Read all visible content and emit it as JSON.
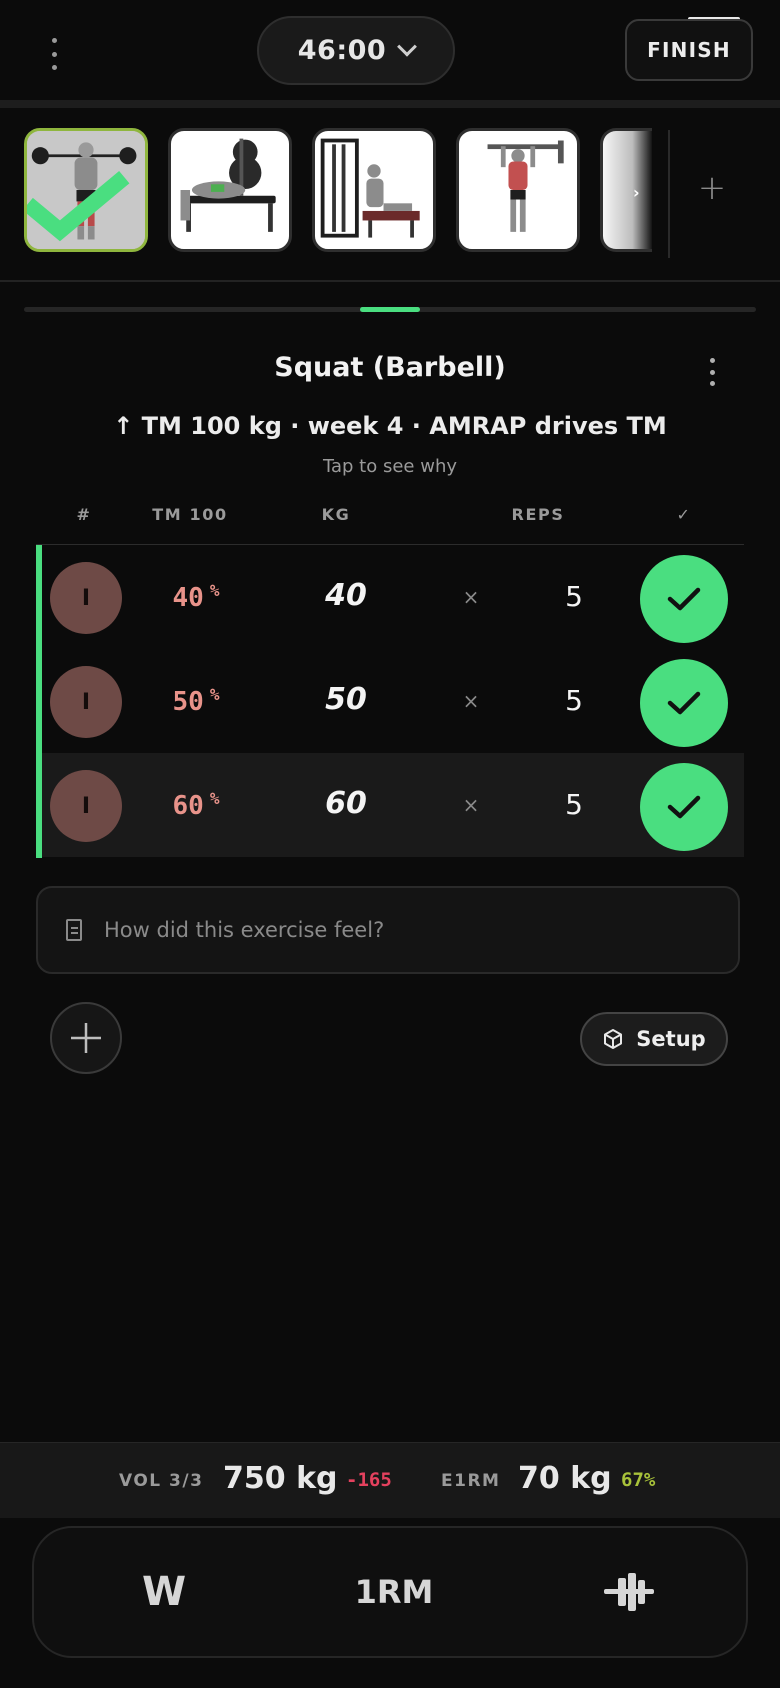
{
  "header": {
    "timer": "46:00",
    "finish_label": "FINISH"
  },
  "thumbnails": [
    {
      "name": "squat-barbell",
      "active": true,
      "done": true
    },
    {
      "name": "bench-press",
      "active": false,
      "done": false
    },
    {
      "name": "seated-row-machine",
      "active": false,
      "done": false
    },
    {
      "name": "pull-up",
      "active": false,
      "done": false
    },
    {
      "name": "next-exercise-partial",
      "active": false,
      "done": false
    }
  ],
  "exercise": {
    "title": "Squat (Barbell)",
    "subtitle": "↑ TM 100 kg · week 4 · AMRAP drives TM",
    "hint": "Tap to see why"
  },
  "table": {
    "headers": {
      "num": "#",
      "tm": "TM 100",
      "kg": "KG",
      "reps": "REPS",
      "check": "✓"
    },
    "rows": [
      {
        "badge": "I",
        "pct": "40",
        "pct_unit": "%",
        "kg": "40",
        "times": "×",
        "reps": "5",
        "done": true
      },
      {
        "badge": "I",
        "pct": "50",
        "pct_unit": "%",
        "kg": "50",
        "times": "×",
        "reps": "5",
        "done": true
      },
      {
        "badge": "I",
        "pct": "60",
        "pct_unit": "%",
        "kg": "60",
        "times": "×",
        "reps": "5",
        "done": true
      }
    ]
  },
  "notes": {
    "placeholder": "How did this exercise feel?"
  },
  "actions": {
    "setup_label": "Setup"
  },
  "stats": {
    "vol_label": "VOL 3/3",
    "vol_value": "750 kg",
    "vol_delta": "-165",
    "e1rm_label": "E1RM",
    "e1rm_value": "70 kg",
    "e1rm_pct": "67%"
  },
  "bottom_nav": {
    "warmup_label": "W",
    "onerm_label": "1RM"
  },
  "colors": {
    "accent_green": "#4ade80",
    "active_border": "#8fb63e",
    "pct_text": "#e8938a",
    "delta_negative": "#e4415e",
    "pct_positive": "#a8c23a"
  }
}
